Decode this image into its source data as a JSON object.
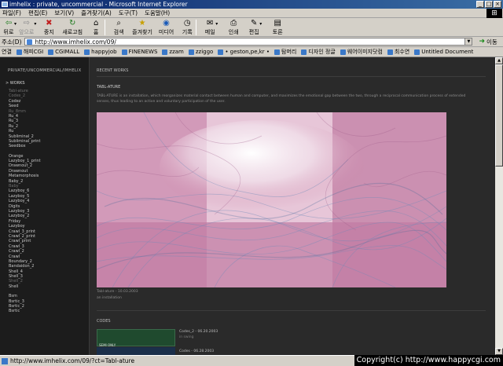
{
  "window": {
    "title": "imhelix : private, uncommercial - Microsoft Internet Explorer",
    "min": "_",
    "max": "□",
    "close": "×"
  },
  "menu": [
    "파일(F)",
    "편집(E)",
    "보기(V)",
    "즐겨찾기(A)",
    "도구(T)",
    "도움말(H)"
  ],
  "toolbar": {
    "back": "뒤로",
    "forward": "앞으로",
    "stop": "중지",
    "refresh": "새로고침",
    "home": "홈",
    "search": "검색",
    "favorites": "즐겨찾기",
    "media": "미디어",
    "history": "기록",
    "mail": "메일",
    "print": "인쇄",
    "edit": "편집",
    "discuss": "토론"
  },
  "address": {
    "label": "주소(D)",
    "url": "http://www.imhelix.com/09/",
    "go": "이동"
  },
  "links": {
    "label": "연결",
    "items": [
      "해피CGI",
      "CGIMALL",
      "happyjob",
      "FINENEWS",
      "zzam",
      "zziggo",
      "• geston,pe,kr •",
      "탐머리",
      "디자인 정글",
      "웨어이미지닷컴",
      "최수연",
      "Untitled Document"
    ]
  },
  "sidebar": {
    "title": "PRIVATE/UNCOMMERCIAL/IMHELIX",
    "category": "> WORKS",
    "items": [
      {
        "label": "Tabl-ature",
        "dim": true
      },
      {
        "label": "Codes_2",
        "dim": true
      },
      {
        "label": "Codez"
      },
      {
        "label": "Seed"
      },
      {
        "label": "Ru_8mm",
        "dim": true
      },
      {
        "label": "Ru_4"
      },
      {
        "label": "Ru_3"
      },
      {
        "label": "Ru_2"
      },
      {
        "label": "Ru"
      },
      {
        "label": "Subliminal_2"
      },
      {
        "label": "Subliminal_print"
      },
      {
        "label": "Seedbox"
      },
      {
        "label": "",
        "gap": true
      },
      {
        "label": "Orange"
      },
      {
        "label": "Lazyboy_1_print"
      },
      {
        "label": "Drawnout_2"
      },
      {
        "label": "Drawnout"
      },
      {
        "label": "Metamorphosis"
      },
      {
        "label": "Baby_2"
      },
      {
        "label": "Baby",
        "dim": true
      },
      {
        "label": "Lazyboy_6"
      },
      {
        "label": "Lazyboy_5"
      },
      {
        "label": "Lazyboy_4"
      },
      {
        "label": "Digits"
      },
      {
        "label": "Lazyboy_3"
      },
      {
        "label": "Lazyboy_2"
      },
      {
        "label": "Friday"
      },
      {
        "label": "Lazyboy"
      },
      {
        "label": "Crawl_3_print"
      },
      {
        "label": "Crawl_2_print"
      },
      {
        "label": "Crawl_print"
      },
      {
        "label": "Crawl_3"
      },
      {
        "label": "Crawl_2"
      },
      {
        "label": "Crawl"
      },
      {
        "label": "Boundary_2"
      },
      {
        "label": "Bandaidon_2"
      },
      {
        "label": "Shell_4"
      },
      {
        "label": "Shell_3"
      },
      {
        "label": "Shell_2",
        "dim": true
      },
      {
        "label": "Shell"
      },
      {
        "label": "",
        "gap": true
      },
      {
        "label": "Bsm"
      },
      {
        "label": "Bsrtic_3"
      },
      {
        "label": "Bsrtic_2"
      },
      {
        "label": "Bsrtic"
      }
    ]
  },
  "main": {
    "section_title": "RECENT WORKS",
    "work_title": "TABL-ATURE",
    "description": "TABL-ATURE is an installation, which reorganizes material contact between human and computer, and maximizes the emotional gap between the two, through a reciprocal communication process of extended senses, thus leading to an active and voluntary participation of the user.",
    "caption_line1": "Tabl-ature - 10.03.2003",
    "caption_line2": "an installation",
    "codes_title": "CODES",
    "code1_title": "Codes_2 - 06.20.2003",
    "code1_sub": "in swing",
    "code2_title": "Codes - 06.28.2003",
    "thumb_label": "SEMI ONLY"
  },
  "status": {
    "text": "http://www.imhelix.com/09/?ct=Tabl-ature"
  },
  "watermark": "Copyright(c) http://www.happycgi.com",
  "colors": {
    "page_bg": "#2a2a2a",
    "sidebar_bg": "#1c1c1c",
    "art_pink": "#c87aa0",
    "art_blue": "#6a8ab8",
    "chrome": "#d4d0c8"
  }
}
